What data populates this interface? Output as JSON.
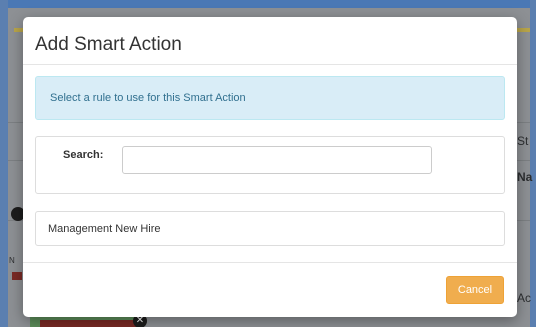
{
  "background": {
    "partial_texts": {
      "st": "St",
      "na": "Na",
      "ac": "Ac",
      "n": "N"
    },
    "close_glyph": "✕"
  },
  "modal": {
    "title": "Add Smart Action",
    "info_message": "Select a rule to use for this Smart Action",
    "search": {
      "label": "Search:",
      "value": "",
      "placeholder": ""
    },
    "rules": [
      {
        "label": "Management New Hire"
      }
    ],
    "cancel_label": "Cancel"
  },
  "colors": {
    "info_bg": "#d9edf7",
    "info_text": "#31708f",
    "cancel_bg": "#f0ad4e"
  }
}
